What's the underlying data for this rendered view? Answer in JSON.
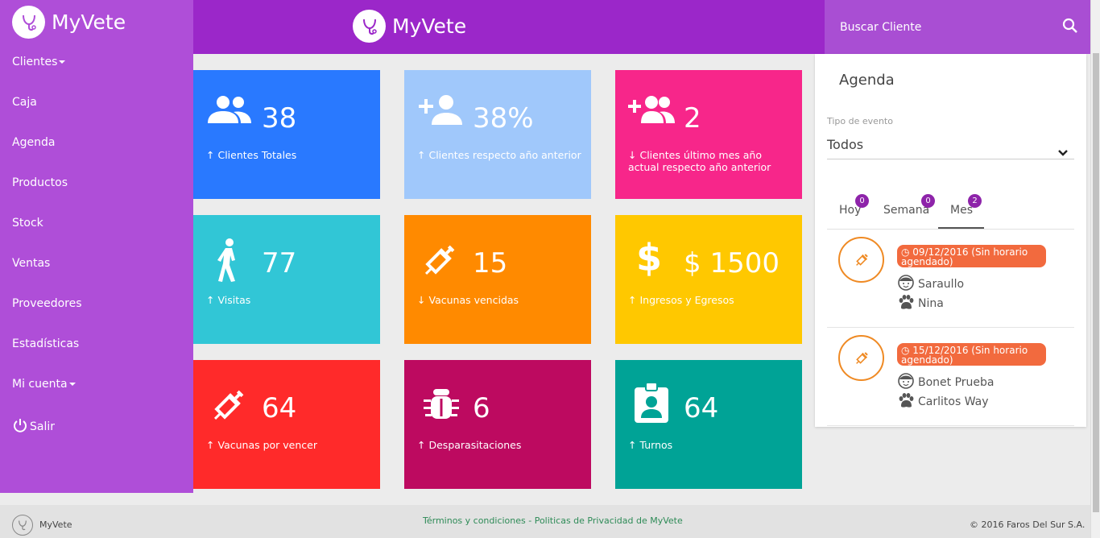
{
  "app": {
    "brand": "MyVete"
  },
  "search": {
    "placeholder": "Buscar Cliente"
  },
  "sidebar": {
    "items": [
      {
        "label": "Clientes",
        "dropdown": true
      },
      {
        "label": "Caja"
      },
      {
        "label": "Agenda"
      },
      {
        "label": "Productos"
      },
      {
        "label": "Stock"
      },
      {
        "label": "Ventas"
      },
      {
        "label": "Proveedores"
      },
      {
        "label": "Estadísticas"
      },
      {
        "label": "Mi cuenta",
        "dropdown": true
      },
      {
        "label": "Salir",
        "icon": "power-icon"
      }
    ]
  },
  "tiles": [
    {
      "value": "38",
      "label": "Clientes Totales",
      "arrow": "↑",
      "color": "#2979ff",
      "icon": "users-icon"
    },
    {
      "value": "38%",
      "label": "Clientes respecto año anterior",
      "arrow": "↑",
      "color": "#a0c8fb",
      "icon": "add-user-icon"
    },
    {
      "value": "2",
      "label": "Clientes último mes año actual respecto año anterior",
      "arrow": "↓",
      "color": "#f7268a",
      "icon": "add-group-icon"
    },
    {
      "value": "77",
      "label": "Visitas",
      "arrow": "↑",
      "color": "#31c6d6",
      "icon": "walking-icon"
    },
    {
      "value": "15",
      "label": "Vacunas vencidas",
      "arrow": "↓",
      "color": "#ff8a00",
      "icon": "syringe-icon"
    },
    {
      "value": "$ 1500",
      "label": "Ingresos y Egresos",
      "arrow": "↑",
      "color": "#ffc800",
      "icon": "dollar-icon"
    },
    {
      "value": "64",
      "label": "Vacunas por vencer",
      "arrow": "↑",
      "color": "#ff2a2a",
      "icon": "syringe-icon"
    },
    {
      "value": "6",
      "label": "Desparasitaciones",
      "arrow": "↑",
      "color": "#bd0a60",
      "icon": "bug-icon"
    },
    {
      "value": "64",
      "label": "Turnos",
      "arrow": "↑",
      "color": "#00a396",
      "icon": "badge-icon"
    }
  ],
  "agenda": {
    "title": "Agenda",
    "filter_label": "Tipo de evento",
    "filter_value": "Todos",
    "tabs": [
      {
        "label": "Hoy",
        "count": "0"
      },
      {
        "label": "Semana",
        "count": "0"
      },
      {
        "label": "Mes",
        "count": "2"
      }
    ],
    "events": [
      {
        "date": "09/12/2016 (Sin horario agendado)",
        "client": "Saraullo",
        "pet": "Nina"
      },
      {
        "date": "15/12/2016 (Sin horario agendado)",
        "client": "Bonet Prueba",
        "pet": "Carlitos Way"
      }
    ]
  },
  "footer": {
    "name": "MyVete",
    "links": "Términos y condiciones - Politicas de Privacidad de MyVete",
    "copyright": "© 2016 Faros Del Sur S.A."
  }
}
